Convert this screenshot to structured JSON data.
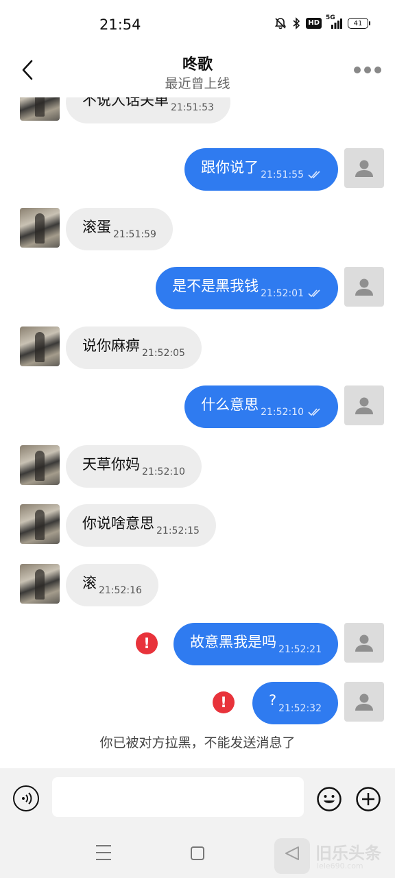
{
  "status_bar": {
    "time": "21:54",
    "signal_label": "5G",
    "hd_label": "HD",
    "battery_level": "41"
  },
  "header": {
    "name": "咚歌",
    "status": "最近曾上线"
  },
  "messages": [
    {
      "text": "不说人话关单",
      "time": "21:51:53"
    },
    {
      "text": "跟你说了",
      "time": "21:51:55"
    },
    {
      "text": "滚蛋",
      "time": "21:51:59"
    },
    {
      "text": "是不是黑我钱",
      "time": "21:52:01"
    },
    {
      "text": "说你麻痹",
      "time": "21:52:05"
    },
    {
      "text": "什么意思",
      "time": "21:52:10"
    },
    {
      "text": "天草你妈",
      "time": "21:52:10"
    },
    {
      "text": "你说啥意思",
      "time": "21:52:15"
    },
    {
      "text": "滚",
      "time": "21:52:16"
    },
    {
      "text": "故意黑我是吗",
      "time": "21:52:21"
    },
    {
      "text": "?",
      "time": "21:52:32"
    }
  ],
  "error_mark": "!",
  "blocked_notice": "你已被对方拉黑，不能发送消息了",
  "input": {
    "placeholder": ""
  },
  "watermark": {
    "text": "旧乐头条",
    "sub": "lele690.com"
  },
  "colors": {
    "outgoing_bubble": "#2f7bf0",
    "incoming_bubble": "#ededed",
    "error": "#e8333b"
  }
}
